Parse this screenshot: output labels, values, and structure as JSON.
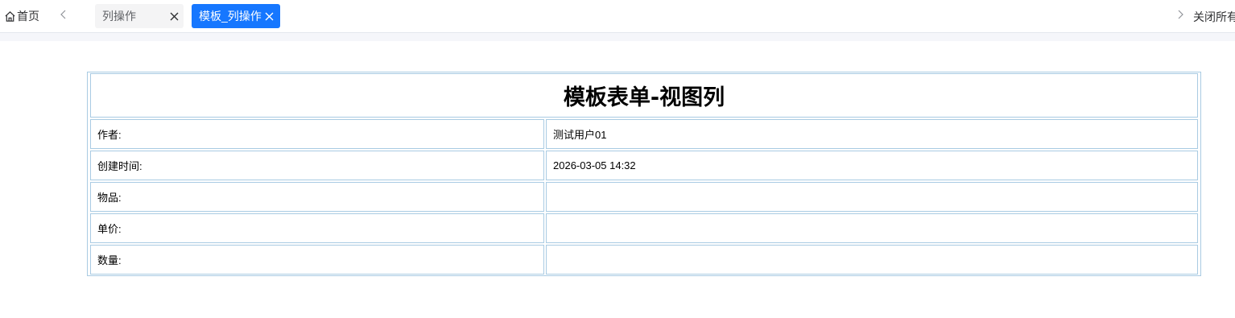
{
  "tabbar": {
    "home_label": "首页",
    "tabs": [
      {
        "label": "列操作",
        "active": false
      },
      {
        "label": "模板_列操作",
        "active": true
      }
    ],
    "close_all_label": "关闭所有"
  },
  "form": {
    "title": "模板表单-视图列",
    "rows": [
      {
        "label": "作者:",
        "value": "测试用户01"
      },
      {
        "label": "创建时间:",
        "value": "2026-03-05 14:32"
      },
      {
        "label": "物品:",
        "value": ""
      },
      {
        "label": "单价:",
        "value": ""
      },
      {
        "label": "数量:",
        "value": ""
      }
    ]
  },
  "colors": {
    "active_tab": "#1677ff",
    "inactive_tab": "#f4f4f5",
    "table_border": "#a9cbe3"
  }
}
